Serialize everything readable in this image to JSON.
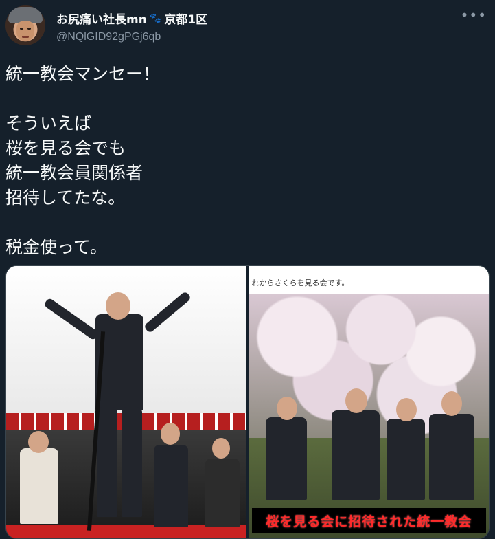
{
  "author": {
    "display_name": "お尻痛い社長mn",
    "display_suffix": "京都1区",
    "handle": "@NQlGID92gPGj6qb"
  },
  "icons": {
    "more": "more-horizontal-icon",
    "name_emoji": "paw-prints-icon"
  },
  "tweet": {
    "text": "統一教会マンセー！\n\nそういえば\n桜を見る会でも\n統一教会員関係者\n招待してたな。\n\n税金使って。"
  },
  "media": {
    "right_photo_caption": "れからさくらを見る会です。",
    "right_photo_banner": "桜を見る会に招待された統一教会"
  },
  "colors": {
    "background": "#15202b",
    "text_primary": "#f7f9f9",
    "text_secondary": "#8b98a5",
    "banner_text": "#ff2a2a"
  }
}
